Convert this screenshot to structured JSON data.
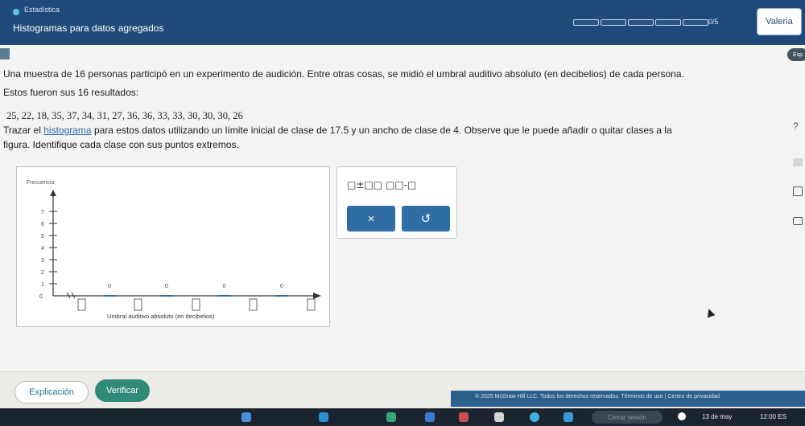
{
  "header": {
    "topic": "Estadística",
    "title": "Histogramas para datos agregados",
    "progress_count": "0/5",
    "user": "Valeria"
  },
  "language_pill": "Esp",
  "problem": {
    "sentence1": "Una muestra de 16 personas participó en un experimento de audición. Entre otras cosas, se midió el umbral auditivo absoluto (en decibelios) de cada persona.",
    "sentence2": "Estos fueron sus 16 resultados:",
    "data": "25, 22, 18, 35, 37, 34, 31, 27, 36, 36, 33, 33, 30, 30, 30, 26",
    "instruction_prefix": "Trazar el ",
    "instruction_link": "histograma",
    "instruction_rest": " para estos datos utilizando un límite inicial de clase de 17.5 y un ancho de clase de 4. Observe que le puede añadir o quitar clases a la",
    "instruction_line2": "figura. Identifique cada clase con sus puntos extremos."
  },
  "graph": {
    "y_label": "Frecuencia",
    "x_label": "Umbral auditivo absoluto (en decibelios)",
    "y_ticks": [
      "1",
      "2",
      "3",
      "4",
      "5",
      "6",
      "7"
    ],
    "y_zero": "0",
    "bar_values": [
      "0",
      "0",
      "0",
      "0"
    ]
  },
  "palette": {
    "tool1_glyph": "□±□□",
    "tool2_glyph": "□□-□",
    "clear_glyph": "×",
    "undo_glyph": "↺"
  },
  "buttons": {
    "explain": "Explicación",
    "verify": "Verificar"
  },
  "footer": {
    "text": "© 2025 McGraw Hill LLC. Todos los derechos reservados.   Términos de uso  |  Centro de privacidad"
  },
  "taskbar": {
    "search": "Cerrar sesión",
    "date": "13 de may",
    "time": "12:00  ES"
  },
  "colors": {
    "header_bg": "#1f4a7a",
    "accent": "#2f6da4",
    "verify": "#2f8a78"
  }
}
